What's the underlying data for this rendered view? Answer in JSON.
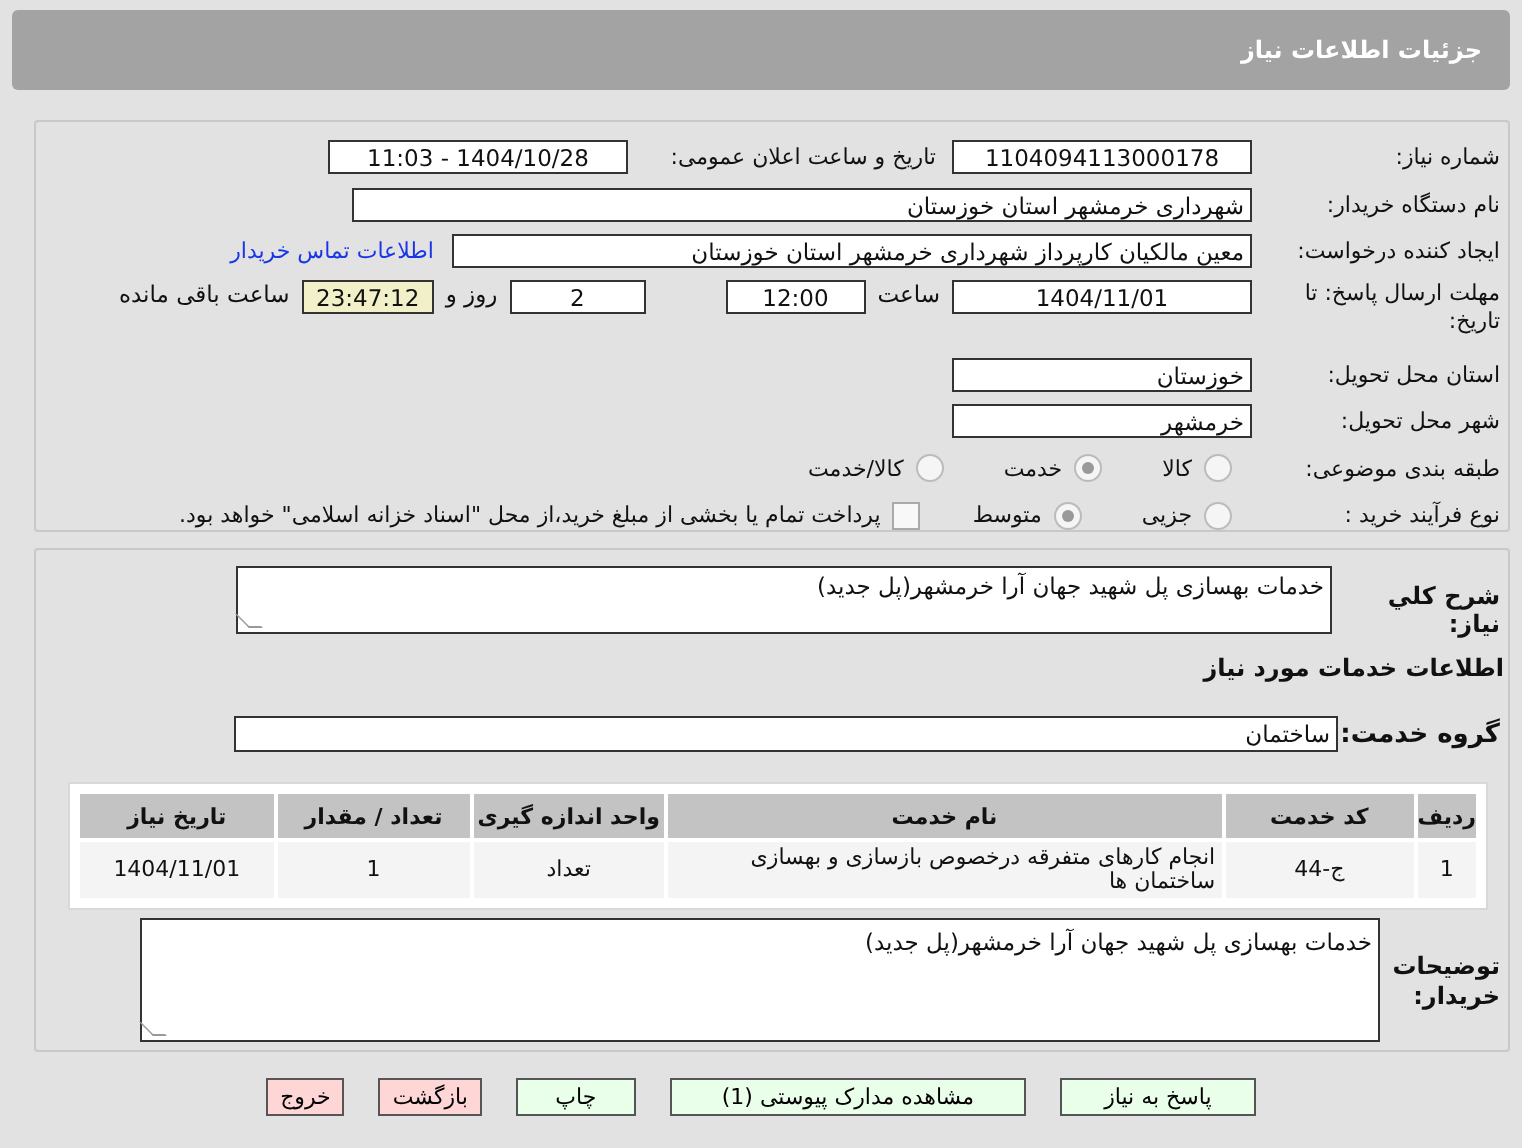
{
  "header": {
    "title": "جزئیات اطلاعات نیاز"
  },
  "info": {
    "need_number": {
      "label": "شماره نیاز:",
      "value": "1104094113000178"
    },
    "announce": {
      "label": "تاریخ و ساعت اعلان عمومی:",
      "value": "1404/10/28 - 11:03"
    },
    "buyer_org": {
      "label": "نام دستگاه خریدار:",
      "value": "شهرداری خرمشهر استان خوزستان"
    },
    "requester": {
      "label": "ایجاد کننده درخواست:",
      "value": "معین مالکیان کارپرداز شهرداری خرمشهر استان خوزستان",
      "link": "اطلاعات تماس خریدار"
    },
    "deadline": {
      "label": "مهلت ارسال پاسخ: تا تاریخ:",
      "date": "1404/11/01",
      "time_label": "ساعت",
      "time": "12:00",
      "days": "2",
      "days_label": "روز و",
      "remaining": "23:47:12",
      "remaining_label": "ساعت باقی مانده"
    },
    "province": {
      "label": "استان محل تحویل:",
      "value": "خوزستان"
    },
    "city": {
      "label": "شهر محل تحویل:",
      "value": "خرمشهر"
    },
    "category": {
      "label": "طبقه بندی موضوعی:",
      "options": [
        {
          "label": "کالا",
          "selected": false
        },
        {
          "label": "خدمت",
          "selected": true
        },
        {
          "label": "کالا/خدمت",
          "selected": false
        }
      ]
    },
    "purchase_type": {
      "label": "نوع فرآیند خرید :",
      "options": [
        {
          "label": "جزیی",
          "selected": false
        },
        {
          "label": "متوسط",
          "selected": true
        }
      ],
      "payment": {
        "checked": false,
        "text": "پرداخت تمام یا بخشی از مبلغ خرید،از محل \"اسناد خزانه اسلامی\" خواهد بود."
      }
    }
  },
  "details": {
    "summary": {
      "label": "شرح کلي نياز:",
      "value": "خدمات بهسازی پل شهید جهان آرا خرمشهر(پل جدید)"
    },
    "services_title": "اطلاعات خدمات مورد نیاز",
    "service_group": {
      "label": "گروه خدمت:",
      "value": "ساختمان"
    },
    "table": {
      "columns": [
        "ردیف",
        "کد خدمت",
        "نام خدمت",
        "واحد اندازه گیری",
        "تعداد / مقدار",
        "تاریخ نیاز"
      ],
      "rows": [
        [
          "1",
          "ج-44",
          "انجام کارهای متفرقه درخصوص بازسازی و بهسازی ساختمان ها",
          "تعداد",
          "1",
          "1404/11/01"
        ]
      ]
    },
    "buyer_notes": {
      "label": "توضیحات خریدار:",
      "value": "خدمات بهسازی پل شهید جهان آرا خرمشهر(پل جدید)"
    }
  },
  "buttons": [
    {
      "label": "پاسخ به نیاز",
      "kind": "green"
    },
    {
      "label": "مشاهده مدارک پیوستی (1)",
      "kind": "green"
    },
    {
      "label": "چاپ",
      "kind": "green"
    },
    {
      "label": "بازگشت",
      "kind": "red"
    },
    {
      "label": "خروج",
      "kind": "red"
    }
  ]
}
